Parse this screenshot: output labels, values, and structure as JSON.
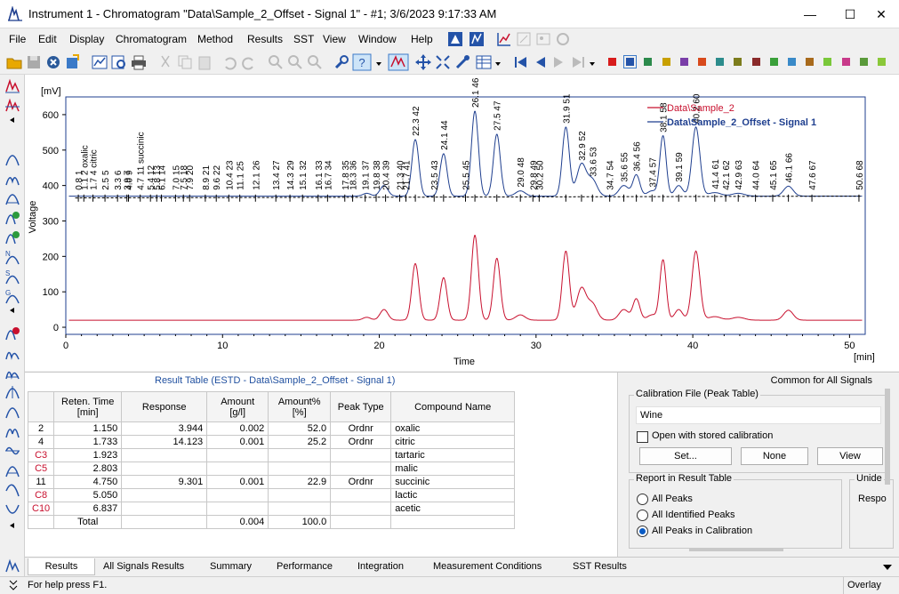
{
  "window": {
    "title": "Instrument 1 - Chromatogram \"Data\\Sample_2_Offset - Signal 1\" - #1;   3/6/2023    9:17:33 AM",
    "minimize": "—",
    "maximize": "☐",
    "close": "✕"
  },
  "menu": [
    "File",
    "Edit",
    "Display",
    "Chromatogram",
    "Method",
    "Results",
    "SST",
    "View",
    "Window",
    "Help"
  ],
  "toolbar": {
    "icons": [
      "open-folder-icon",
      "save-icon",
      "close-doc-icon",
      "export-icon",
      "chart-icon",
      "preview-icon",
      "print-icon",
      "cut-icon",
      "copy-icon",
      "paste-icon",
      "undo-icon",
      "redo-icon",
      "zoom-in-icon",
      "zoom-out-icon",
      "zoom-reset-icon",
      "wrench-icon",
      "help-icon",
      "signal-icon",
      "move-icon",
      "fit-icon",
      "tools-icon",
      "table-icon",
      "first-icon",
      "prev-icon",
      "next-icon",
      "last-icon"
    ],
    "colors": [
      "#d81c1c",
      "#2453a8",
      "#2c8a4c",
      "#c8a000",
      "#7a3ea8",
      "#d84a1c",
      "#2c8c8c",
      "#7c7c1c",
      "#8a2a2a",
      "#3aa03a",
      "#3a8ac8",
      "#a86a1c",
      "#7ac83a",
      "#c83a8a",
      "#5a9a3a",
      "#8ac83a"
    ]
  },
  "chart": {
    "y_unit": "[mV]",
    "y_axis_label": "Voltage",
    "x_axis_label": "Time",
    "x_unit": "[min]",
    "legend": [
      {
        "label": "Data\\Sample_2",
        "color": "#c8102e"
      },
      {
        "label": "Data\\Sample_2_Offset - Signal 1",
        "color": "#1f3f8f"
      }
    ]
  },
  "chart_data": {
    "type": "line",
    "xlim": [
      0,
      51
    ],
    "ylim": [
      -20,
      650
    ],
    "x_ticks": [
      0,
      10,
      20,
      30,
      40,
      50
    ],
    "y_ticks": [
      0,
      100,
      200,
      300,
      400,
      500,
      600
    ],
    "series": [
      {
        "name": "Data\\Sample_2",
        "color": "#c8102e",
        "offset": 0,
        "baseline": 20,
        "peaks": [
          [
            19.2,
            8,
            0.25
          ],
          [
            20.3,
            30,
            0.25
          ],
          [
            22.3,
            160,
            0.22
          ],
          [
            24.1,
            120,
            0.22
          ],
          [
            26.1,
            240,
            0.22
          ],
          [
            27.5,
            175,
            0.22
          ],
          [
            29.0,
            15,
            0.3
          ],
          [
            31.9,
            195,
            0.22
          ],
          [
            32.9,
            90,
            0.3
          ],
          [
            33.6,
            45,
            0.3
          ],
          [
            35.6,
            30,
            0.3
          ],
          [
            36.4,
            60,
            0.22
          ],
          [
            37.4,
            15,
            0.3
          ],
          [
            38.1,
            170,
            0.2
          ],
          [
            39.1,
            30,
            0.25
          ],
          [
            40.2,
            195,
            0.25
          ],
          [
            41.4,
            10,
            0.4
          ],
          [
            42.9,
            8,
            0.4
          ],
          [
            46.1,
            28,
            0.3
          ]
        ]
      },
      {
        "name": "Data\\Sample_2_Offset - Signal 1",
        "color": "#1f3f8f",
        "offset": 350,
        "baseline": 20,
        "peaks": [
          [
            19.2,
            8,
            0.25
          ],
          [
            20.3,
            30,
            0.25
          ],
          [
            22.3,
            160,
            0.22
          ],
          [
            24.1,
            120,
            0.22
          ],
          [
            26.1,
            240,
            0.22
          ],
          [
            27.5,
            175,
            0.22
          ],
          [
            29.0,
            15,
            0.3
          ],
          [
            31.9,
            195,
            0.22
          ],
          [
            32.9,
            90,
            0.3
          ],
          [
            33.6,
            45,
            0.3
          ],
          [
            35.6,
            30,
            0.3
          ],
          [
            36.4,
            60,
            0.22
          ],
          [
            37.4,
            15,
            0.3
          ],
          [
            38.1,
            170,
            0.2
          ],
          [
            39.1,
            30,
            0.25
          ],
          [
            40.2,
            195,
            0.25
          ],
          [
            41.4,
            10,
            0.4
          ],
          [
            42.9,
            8,
            0.4
          ],
          [
            46.1,
            28,
            0.3
          ]
        ]
      }
    ],
    "peak_labels": [
      {
        "t": 0.8,
        "time": "0.8",
        "num": "1"
      },
      {
        "t": 1.15,
        "time": "1.1",
        "num": "2",
        "name": "oxalic"
      },
      {
        "t": 1.733,
        "time": "1.7",
        "num": "4",
        "name": "citric"
      },
      {
        "t": 2.5,
        "time": "2.5",
        "num": "5"
      },
      {
        "t": 3.3,
        "time": "3.3",
        "num": "6"
      },
      {
        "t": 3.9,
        "time": "3.9",
        "num": "7"
      },
      {
        "t": 4.0,
        "time": "4.0",
        "num": "9"
      },
      {
        "t": 4.75,
        "time": "4.7",
        "num": "11",
        "name": "succinic"
      },
      {
        "t": 5.4,
        "time": "5.4",
        "num": "12"
      },
      {
        "t": 5.8,
        "time": "5.8",
        "num": "13"
      },
      {
        "t": 6.1,
        "time": "6.1",
        "num": "14"
      },
      {
        "t": 7.0,
        "time": "7.0",
        "num": "15"
      },
      {
        "t": 7.5,
        "time": "7.5",
        "num": "18"
      },
      {
        "t": 7.9,
        "time": "7.9",
        "num": "20"
      },
      {
        "t": 8.9,
        "time": "8.9",
        "num": "21"
      },
      {
        "t": 9.6,
        "time": "9.6",
        "num": "22"
      },
      {
        "t": 10.4,
        "time": "10.4",
        "num": "23"
      },
      {
        "t": 11.1,
        "time": "11.1",
        "num": "25"
      },
      {
        "t": 12.1,
        "time": "12.1",
        "num": "26"
      },
      {
        "t": 13.4,
        "time": "13.4",
        "num": "27"
      },
      {
        "t": 14.3,
        "time": "14.3",
        "num": "29"
      },
      {
        "t": 15.1,
        "time": "15.1",
        "num": "32"
      },
      {
        "t": 16.1,
        "time": "16.1",
        "num": "33"
      },
      {
        "t": 16.7,
        "time": "16.7",
        "num": "34"
      },
      {
        "t": 17.8,
        "time": "17.8",
        "num": "35"
      },
      {
        "t": 18.3,
        "time": "18.3",
        "num": "36"
      },
      {
        "t": 19.1,
        "time": "19.1",
        "num": "37"
      },
      {
        "t": 19.8,
        "time": "19.8",
        "num": "38"
      },
      {
        "t": 20.4,
        "time": "20.4",
        "num": "39"
      },
      {
        "t": 21.3,
        "time": "21.3",
        "num": "40"
      },
      {
        "t": 21.7,
        "time": "21.7",
        "num": "41"
      },
      {
        "t": 22.3,
        "time": "22.3",
        "num": "42"
      },
      {
        "t": 23.5,
        "time": "23.5",
        "num": "43"
      },
      {
        "t": 24.1,
        "time": "24.1",
        "num": "44"
      },
      {
        "t": 25.5,
        "time": "25.5",
        "num": "45"
      },
      {
        "t": 26.1,
        "time": "26.1",
        "num": "46"
      },
      {
        "t": 27.5,
        "time": "27.5",
        "num": "47"
      },
      {
        "t": 29.0,
        "time": "29.0",
        "num": "48"
      },
      {
        "t": 29.8,
        "time": "29.8",
        "num": "49"
      },
      {
        "t": 30.2,
        "time": "30.2",
        "num": "50"
      },
      {
        "t": 31.9,
        "time": "31.9",
        "num": "51"
      },
      {
        "t": 32.9,
        "time": "32.9",
        "num": "52"
      },
      {
        "t": 33.6,
        "time": "33.6",
        "num": "53"
      },
      {
        "t": 34.7,
        "time": "34.7",
        "num": "54"
      },
      {
        "t": 35.6,
        "time": "35.6",
        "num": "55"
      },
      {
        "t": 36.4,
        "time": "36.4",
        "num": "56"
      },
      {
        "t": 37.4,
        "time": "37.4",
        "num": "57"
      },
      {
        "t": 38.1,
        "time": "38.1",
        "num": "58"
      },
      {
        "t": 39.1,
        "time": "39.1",
        "num": "59"
      },
      {
        "t": 40.2,
        "time": "40.2",
        "num": "60"
      },
      {
        "t": 41.4,
        "time": "41.4",
        "num": "61"
      },
      {
        "t": 42.1,
        "time": "42.1",
        "num": "62"
      },
      {
        "t": 42.9,
        "time": "42.9",
        "num": "63"
      },
      {
        "t": 44.0,
        "time": "44.0",
        "num": "64"
      },
      {
        "t": 45.1,
        "time": "45.1",
        "num": "65"
      },
      {
        "t": 46.1,
        "time": "46.1",
        "num": "66"
      },
      {
        "t": 47.6,
        "time": "47.6",
        "num": "67"
      },
      {
        "t": 50.6,
        "time": "50.6",
        "num": "68"
      }
    ]
  },
  "result_table": {
    "title": "Result Table (ESTD - Data\\Sample_2_Offset - Signal 1)",
    "headers": [
      "",
      "Reten. Time\n[min]",
      "Response",
      "Amount\n[g/l]",
      "Amount%\n[%]",
      "Peak Type",
      "Compound Name"
    ],
    "rows": [
      {
        "id": "2",
        "id_red": false,
        "time": "1.150",
        "response": "3.944",
        "amount": "0.002",
        "pct": "52.0",
        "type": "Ordnr",
        "name": "oxalic"
      },
      {
        "id": "4",
        "id_red": false,
        "time": "1.733",
        "response": "14.123",
        "amount": "0.001",
        "pct": "25.2",
        "type": "Ordnr",
        "name": "citric"
      },
      {
        "id": "C3",
        "id_red": true,
        "time": "1.923",
        "response": "",
        "amount": "",
        "pct": "",
        "type": "",
        "name": "tartaric"
      },
      {
        "id": "C5",
        "id_red": true,
        "time": "2.803",
        "response": "",
        "amount": "",
        "pct": "",
        "type": "",
        "name": "malic"
      },
      {
        "id": "11",
        "id_red": false,
        "time": "4.750",
        "response": "9.301",
        "amount": "0.001",
        "pct": "22.9",
        "type": "Ordnr",
        "name": "succinic"
      },
      {
        "id": "C8",
        "id_red": true,
        "time": "5.050",
        "response": "",
        "amount": "",
        "pct": "",
        "type": "",
        "name": "lactic"
      },
      {
        "id": "C10",
        "id_red": true,
        "time": "6.837",
        "response": "",
        "amount": "",
        "pct": "",
        "type": "",
        "name": "acetic"
      }
    ],
    "total_label": "Total",
    "total_amount": "0.004",
    "total_pct": "100.0"
  },
  "panel": {
    "header": "Common for All Signals",
    "calibration_group": "Calibration File (Peak Table)",
    "calibration_value": "Wine",
    "open_stored": "Open with stored calibration",
    "set_button": "Set...",
    "none_button": "None",
    "view_button": "View",
    "report_group": "Report in Result Table",
    "options": [
      "All Peaks",
      "All Identified Peaks",
      "All Peaks in Calibration"
    ],
    "selected_option": 2,
    "unidentified_group": "Unide",
    "unidentified_text": "Respo"
  },
  "tabs": [
    "Results",
    "All Signals Results",
    "Summary",
    "Performance",
    "Integration",
    "Measurement Conditions",
    "SST Results"
  ],
  "status": {
    "help": "For help press F1.",
    "mode": "Overlay"
  }
}
